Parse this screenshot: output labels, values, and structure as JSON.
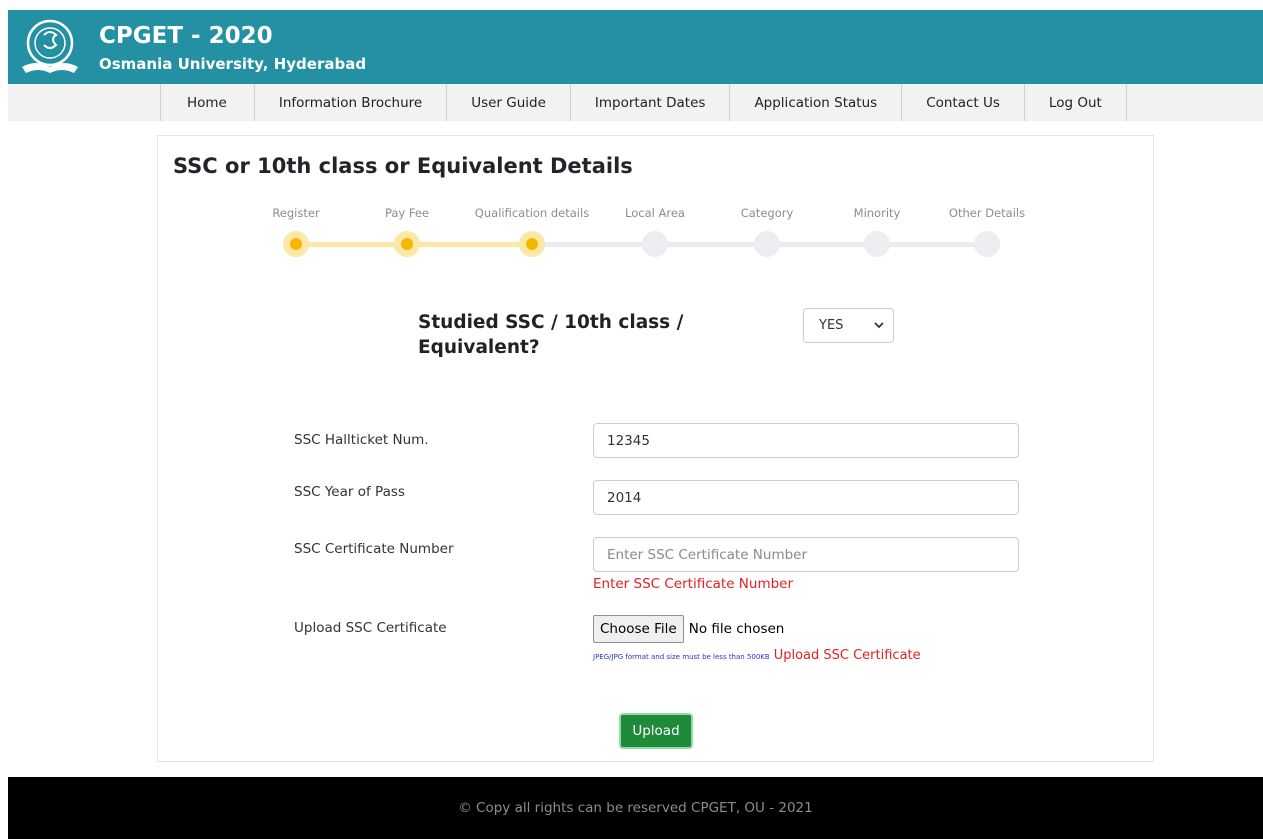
{
  "header": {
    "title": "CPGET - 2020",
    "subtitle": "Osmania University, Hyderabad",
    "logo_icon": "university-seal-icon",
    "bg_color": "#2390a4"
  },
  "nav": {
    "items": [
      {
        "label": "Home"
      },
      {
        "label": "Information Brochure"
      },
      {
        "label": "User Guide"
      },
      {
        "label": "Important Dates"
      },
      {
        "label": "Application Status"
      },
      {
        "label": "Contact Us"
      },
      {
        "label": "Log Out"
      }
    ]
  },
  "page": {
    "title": "SSC or 10th class or Equivalent Details"
  },
  "stepper": {
    "steps": [
      {
        "label": "Register",
        "done": true
      },
      {
        "label": "Pay Fee",
        "done": true
      },
      {
        "label": "Qualification details",
        "done": true
      },
      {
        "label": "Local Area",
        "done": false
      },
      {
        "label": "Category",
        "done": false
      },
      {
        "label": "Minority",
        "done": false
      },
      {
        "label": "Other Details",
        "done": false
      }
    ],
    "done_color": "#f7b500"
  },
  "question": {
    "text": "Studied SSC / 10th class / Equivalent?",
    "selected": "YES"
  },
  "form": {
    "hallticket": {
      "label": "SSC Hallticket Num.",
      "value": "12345"
    },
    "year": {
      "label": "SSC Year of Pass",
      "value": "2014"
    },
    "certificate": {
      "label": "SSC Certificate Number",
      "placeholder": "Enter SSC Certificate Number",
      "error": "Enter SSC Certificate Number"
    },
    "upload": {
      "label": "Upload SSC Certificate",
      "button": "Choose File",
      "status": "No file chosen",
      "hint": "JPEG/JPG format and size must be less than 500KB",
      "error": "Upload SSC Certificate"
    },
    "submit_label": "Upload"
  },
  "footer": {
    "text": "© Copy all rights can be reserved CPGET, OU - 2021"
  }
}
